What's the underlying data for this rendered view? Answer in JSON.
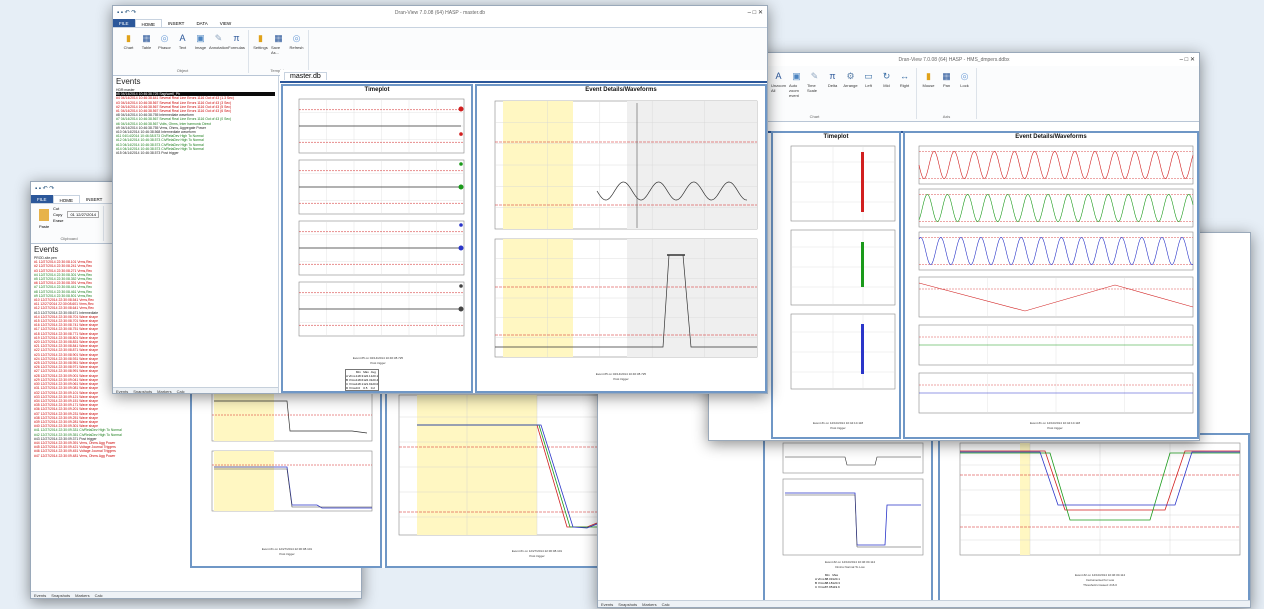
{
  "windows": [
    {
      "key": "main",
      "title": "Dran-View 7.0.08 (64) HASP - master.db",
      "tabs": [
        "FILE",
        "HOME",
        "INSERT",
        "DATA",
        "VIEW"
      ],
      "groups": [
        {
          "label": "Object",
          "buttons": [
            "Chart",
            "Table",
            "Phasor",
            "Text",
            "Image",
            "Annotation",
            "Formulas"
          ]
        },
        {
          "label": "Template",
          "buttons": [
            "Settings",
            "Save As...",
            "Refresh"
          ]
        }
      ],
      "panel_title": "Events",
      "doc_tab": "master.db",
      "timeplot_title": "Timeplot",
      "event_title": "Event Details/Waveforms",
      "tree": [
        {
          "t": "HDR:master",
          "c": "k"
        },
        {
          "t": "#5 04/14/2014 10:46:38.725 Sag/swell_Ph",
          "c": "sel"
        },
        {
          "t": "#4 04/14/2014 10:46:38.641 Several Real Line Errors 1116 Out of 43 (1.3 Sec)",
          "c": "r"
        },
        {
          "t": "#3 04/14/2014 10:46:38.567 Several Real Line Errors 1116 Out of 43 (3 Sec)",
          "c": "r"
        },
        {
          "t": "#2 04/14/2014 10:46:38.567 Several Real Line Errors 1116 Out of 43 (5 Sec)",
          "c": "r"
        },
        {
          "t": "#1 04/14/2014 10:46:38.567 Several Real Line Errors 1116 Out of 43 (6 Sec)",
          "c": "r"
        },
        {
          "t": "#8 04/14/2014 10:46:38.755 Intermediate waveform",
          "c": "k"
        },
        {
          "t": "#7 04/14/2014 10:46:38.567 Several Real Line Errors 1116 Out of 43 (0 Sec)",
          "c": "g"
        },
        {
          "t": "#6 04/14/2014 10:46:38.567 Volts, Ohms, Inter harmonic Direct",
          "c": "g"
        },
        {
          "t": "#9 04/14/2014 10:46:38.755 Vrms, Ohms, Aggregate Power",
          "c": "k"
        },
        {
          "t": "#10 04/14/2014 10:46:38.568 Intermediate waveform",
          "c": "k"
        },
        {
          "t": "#11 04/14/2014 10:46:38.573 Ch/RelaDev High To Normal",
          "c": "g"
        },
        {
          "t": "#12 04/14/2014 10:46:38.573 Ch/RelaDev High To Normal",
          "c": "g"
        },
        {
          "t": "#13 04/14/2014 10:46:38.573 Ch/RelaDev High To Normal",
          "c": "g"
        },
        {
          "t": "#14 04/14/2014 10:46:38.573 Ch/RelaDev High To Normal",
          "c": "g"
        },
        {
          "t": "#15 04/14/2014 10:46:38.573 Post trigger",
          "c": "k"
        }
      ],
      "bottom_tabs": [
        "Events",
        "Snapshots",
        "Markers",
        "Calc"
      ],
      "caption1": "Event #5 on 04/14/2014 10:46:38.725",
      "caption2": "Post trigger",
      "event_caption1": "Event #5 on 04/14/2014 10:46:38.725",
      "event_caption2": "Post trigger",
      "table": {
        "header": [
          "",
          "Min",
          "Max",
          "Avg"
        ],
        "rows": [
          [
            "A Vrms",
            "118.3",
            "122.1",
            "120.1"
          ],
          [
            "B Vrms",
            "118.6",
            "122.3",
            "120.4"
          ],
          [
            "C Vrms",
            "118.1",
            "121.9",
            "120.0"
          ],
          [
            "D Vrms",
            "0.0",
            "0.5",
            "0.2"
          ]
        ]
      }
    },
    {
      "key": "left",
      "title": "Dran-View",
      "tabs": [
        "FILE",
        "HOME",
        "INSERT",
        "DATA"
      ],
      "clip": [
        "Cut",
        "Copy",
        "Paste",
        "Erase"
      ],
      "clip_label": "Clipboard",
      "date": "01 12/27/2014",
      "panel_title": "Events",
      "root": "PROD-site.pen",
      "tree": [
        {
          "t": "#1 12/27/2014 22:30:08.101 Vrms,Rec",
          "c": "r"
        },
        {
          "t": "#2 12/27/2014 22:30:08.241 Vrms,Rec",
          "c": "r"
        },
        {
          "t": "#3 12/27/2014 22:30:08.271 Vrms,Rec",
          "c": "r"
        },
        {
          "t": "#4 12/27/2014 22:30:08.301 Vrms,Rec",
          "c": "g"
        },
        {
          "t": "#5 12/27/2014 22:30:08.352 Vrms,Rec",
          "c": "g"
        },
        {
          "t": "#6 12/27/2014 22:30:08.391 Vrms,Rec",
          "c": "r"
        },
        {
          "t": "#7 12/27/2014 22:30:08.441 Vrms,Rec",
          "c": "g"
        },
        {
          "t": "#8 12/27/2014 22:30:08.461 Vrms,Rec",
          "c": "g"
        },
        {
          "t": "#9 12/27/2014 22:30:08.501 Vrms,Rec",
          "c": "g"
        },
        {
          "t": "#10 12/27/2014 22:30:08.541 Vrms,Rec",
          "c": "r"
        },
        {
          "t": "#11 12/27/2014 22:30:08.601 Vrms,Rec",
          "c": "r"
        },
        {
          "t": "#12 12/27/2014 22:30:08.641 Vrms,Rec",
          "c": "r"
        },
        {
          "t": "#13 12/27/2014 22:30:08.671 Intermediate",
          "c": "k"
        },
        {
          "t": "#14 12/27/2014 22:30:08.701 Wave shape",
          "c": "r"
        },
        {
          "t": "#15 12/27/2014 22:30:08.701 Wave shape",
          "c": "r"
        },
        {
          "t": "#16 12/27/2014 22:30:08.741 Wave shape",
          "c": "r"
        },
        {
          "t": "#17 12/27/2014 22:30:08.751 Wave shape",
          "c": "r"
        },
        {
          "t": "#18 12/27/2014 22:30:08.771 Wave shape",
          "c": "r"
        },
        {
          "t": "#19 12/27/2014 22:30:08.801 Wave shape",
          "c": "r"
        },
        {
          "t": "#20 12/27/2014 22:30:08.831 Wave shape",
          "c": "r"
        },
        {
          "t": "#21 12/27/2014 22:30:08.841 Wave shape",
          "c": "r"
        },
        {
          "t": "#22 12/27/2014 22:30:08.871 Wave shape",
          "c": "r"
        },
        {
          "t": "#23 12/27/2014 22:30:08.901 Wave shape",
          "c": "r"
        },
        {
          "t": "#24 12/27/2014 22:30:08.931 Wave shape",
          "c": "r"
        },
        {
          "t": "#25 12/27/2014 22:30:08.951 Wave shape",
          "c": "r"
        },
        {
          "t": "#26 12/27/2014 22:30:08.971 Wave shape",
          "c": "r"
        },
        {
          "t": "#27 12/27/2014 22:30:08.991 Wave shape",
          "c": "r"
        },
        {
          "t": "#28 12/27/2014 22:30:09.001 Wave shape",
          "c": "r"
        },
        {
          "t": "#29 12/27/2014 22:30:09.041 Wave shape",
          "c": "r"
        },
        {
          "t": "#30 12/27/2014 22:30:09.061 Wave shape",
          "c": "r"
        },
        {
          "t": "#31 12/27/2014 22:30:09.081 Wave shape",
          "c": "r"
        },
        {
          "t": "#32 12/27/2014 22:30:09.101 Wave shape",
          "c": "r"
        },
        {
          "t": "#33 12/27/2014 22:30:09.121 Wave shape",
          "c": "r"
        },
        {
          "t": "#34 12/27/2014 22:30:09.151 Wave shape",
          "c": "r"
        },
        {
          "t": "#35 12/27/2014 22:30:09.171 Wave shape",
          "c": "r"
        },
        {
          "t": "#36 12/27/2014 22:30:09.201 Wave shape",
          "c": "r"
        },
        {
          "t": "#37 12/27/2014 22:30:09.231 Wave shape",
          "c": "r"
        },
        {
          "t": "#38 12/27/2014 22:30:09.251 Wave shape",
          "c": "r"
        },
        {
          "t": "#39 12/27/2014 22:30:09.281 Wave shape",
          "c": "r"
        },
        {
          "t": "#40 12/27/2014 22:30:09.301 Wave shape",
          "c": "r"
        },
        {
          "t": "#41 12/27/2014 22:30:09.331 Ch/RelaDev High To Normal",
          "c": "g"
        },
        {
          "t": "#42 12/27/2014 22:30:09.351 Ch/RelaDev High To Normal",
          "c": "g"
        },
        {
          "t": "#43 12/27/2014 22:30:09.371 Post trigger",
          "c": "k"
        },
        {
          "t": "#44 12/27/2014 22:30:09.391 Vrms, Ohms Agg Power",
          "c": "r"
        },
        {
          "t": "#45 12/27/2014 22:30:09.421 Voltage Journal Triggers",
          "c": "r"
        },
        {
          "t": "#46 12/27/2014 22:30:09.451 Voltage Journal Triggers",
          "c": "r"
        },
        {
          "t": "#47 12/27/2014 22:30:09.481 Vrms, Ohms Agg Power",
          "c": "r"
        }
      ],
      "bottom_tabs": [
        "Events",
        "Snapshots",
        "Markers",
        "Calc"
      ],
      "caption1": "Event #1 on 12/27/2014 22:30:08.101",
      "caption2": "Post trigger",
      "event_caption1": "Event #1 on 12/27/2014 22:30:08.101",
      "event_caption2": "Post trigger"
    },
    {
      "key": "right",
      "title": "Dran-View 7.0.08 (64) HASP - HMS_dmpers.ddbx",
      "groups": [
        {
          "label": "Chart",
          "buttons": [
            "Move",
            "Zoom",
            "Unzoom",
            "Unzoom All",
            "Auto zoom event",
            "Time Scale",
            "Delta",
            "Arrange",
            "Left",
            "Mid",
            "Right"
          ]
        },
        {
          "label": "Axis",
          "buttons": [
            "Mouse",
            "Pan",
            "Lock"
          ]
        }
      ],
      "doc_tab": "ddbx",
      "timeplot_title": "Timeplot",
      "event_title": "Event Details/Waveforms",
      "caption1": "Event #1 on 12/10/2014 10:44:10.118",
      "caption2": "Post trigger",
      "event_caption1": "Event #1 on 12/10/2014 10:44:10.118",
      "event_caption2": "Post trigger"
    },
    {
      "key": "bottom",
      "bottom_tabs": [
        "Events",
        "Snapshots",
        "Markers",
        "Calc"
      ],
      "caption1": "Event #2 on 12/10/2014 10:46:30.114",
      "caption2": "Dmins Normal To Low",
      "event_caption1": "Event #2 on 12/10/2014 10:46:30.114",
      "event_caption2": "Instrumented for Low",
      "threshold": "Threshold crossed: 216.0",
      "table": {
        "header": [
          "",
          "Min",
          "Max"
        ],
        "rows": [
          [
            "A Vrms",
            "88.03",
            "120.1"
          ],
          [
            "B Vrms",
            "88.18",
            "120.3"
          ],
          [
            "C Vrms",
            "87.95",
            "119.9"
          ]
        ]
      }
    }
  ],
  "colors": {
    "phaseA": "#d11f1f",
    "phaseB": "#1a9a1a",
    "phaseC": "#2a35c9",
    "neutral": "#444444",
    "highlight": "#fff7c2",
    "accent": "#2b579a"
  }
}
